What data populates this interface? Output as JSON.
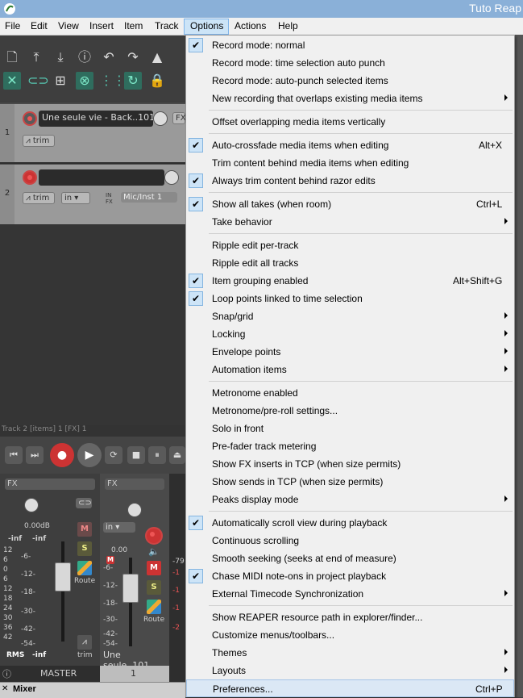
{
  "window": {
    "title": "Tuto Reap"
  },
  "menubar": [
    "File",
    "Edit",
    "View",
    "Insert",
    "Item",
    "Track",
    "Options",
    "Actions",
    "Help"
  ],
  "options_menu": [
    {
      "type": "item",
      "label": "Record mode: normal",
      "checked": true
    },
    {
      "type": "item",
      "label": "Record mode: time selection auto punch"
    },
    {
      "type": "item",
      "label": "Record mode: auto-punch selected items"
    },
    {
      "type": "item",
      "label": "New recording that overlaps existing media items",
      "submenu": true
    },
    {
      "type": "sep"
    },
    {
      "type": "item",
      "label": "Offset overlapping media items vertically"
    },
    {
      "type": "sep"
    },
    {
      "type": "item",
      "label": "Auto-crossfade media items when editing",
      "checked": true,
      "shortcut": "Alt+X"
    },
    {
      "type": "item",
      "label": "Trim content behind media items when editing"
    },
    {
      "type": "item",
      "label": "Always trim content behind razor edits",
      "checked": true
    },
    {
      "type": "sep"
    },
    {
      "type": "item",
      "label": "Show all takes (when room)",
      "checked": true,
      "shortcut": "Ctrl+L"
    },
    {
      "type": "item",
      "label": "Take behavior",
      "submenu": true
    },
    {
      "type": "sep"
    },
    {
      "type": "item",
      "label": "Ripple edit per-track"
    },
    {
      "type": "item",
      "label": "Ripple edit all tracks"
    },
    {
      "type": "item",
      "label": "Item grouping enabled",
      "checked": true,
      "shortcut": "Alt+Shift+G"
    },
    {
      "type": "item",
      "label": "Loop points linked to time selection",
      "checked": true
    },
    {
      "type": "item",
      "label": "Snap/grid",
      "submenu": true
    },
    {
      "type": "item",
      "label": "Locking",
      "submenu": true
    },
    {
      "type": "item",
      "label": "Envelope points",
      "submenu": true
    },
    {
      "type": "item",
      "label": "Automation items",
      "submenu": true
    },
    {
      "type": "sep"
    },
    {
      "type": "item",
      "label": "Metronome enabled"
    },
    {
      "type": "item",
      "label": "Metronome/pre-roll settings..."
    },
    {
      "type": "item",
      "label": "Solo in front"
    },
    {
      "type": "item",
      "label": "Pre-fader track metering"
    },
    {
      "type": "item",
      "label": "Show FX inserts in TCP (when size permits)"
    },
    {
      "type": "item",
      "label": "Show sends in TCP (when size permits)"
    },
    {
      "type": "item",
      "label": "Peaks display mode",
      "submenu": true
    },
    {
      "type": "sep"
    },
    {
      "type": "item",
      "label": "Automatically scroll view during playback",
      "checked": true
    },
    {
      "type": "item",
      "label": "Continuous scrolling"
    },
    {
      "type": "item",
      "label": "Smooth seeking (seeks at end of measure)"
    },
    {
      "type": "item",
      "label": "Chase MIDI note-ons in project playback",
      "checked": true
    },
    {
      "type": "item",
      "label": "External Timecode Synchronization",
      "submenu": true
    },
    {
      "type": "sep"
    },
    {
      "type": "item",
      "label": "Show REAPER resource path in explorer/finder..."
    },
    {
      "type": "item",
      "label": "Customize menus/toolbars..."
    },
    {
      "type": "item",
      "label": "Themes",
      "submenu": true
    },
    {
      "type": "item",
      "label": "Layouts",
      "submenu": true
    },
    {
      "type": "item",
      "label": "Preferences...",
      "shortcut": "Ctrl+P",
      "highlighted": true
    }
  ],
  "tracks": [
    {
      "number": "1",
      "name": "Une seule vie - Back..101",
      "trim": "trim",
      "fx": "FX"
    },
    {
      "number": "2",
      "name": "",
      "trim": "trim",
      "input": "in",
      "input_fx": "IN FX",
      "input_name": "Mic/Inst 1"
    }
  ],
  "status_line": "Track 2 [items] 1 [FX] 1",
  "mixer": {
    "master": {
      "fx": "FX",
      "volume": "0.00dB",
      "peak_l": "-inf",
      "peak_r": "-inf",
      "scale_l": [
        "12",
        "6",
        "0",
        "6",
        "12",
        "18",
        "24",
        "30",
        "36",
        "42"
      ],
      "scale_r": [
        "-6-",
        "-12-",
        "-18-",
        "-30-",
        "-42-",
        "-54-"
      ],
      "m": "M",
      "s": "S",
      "route": "Route",
      "trim": "trim",
      "rms_label": "RMS",
      "rms_value": "-inf",
      "name": "MASTER"
    },
    "track1": {
      "fx": "FX",
      "volume": "0.00",
      "input": "in",
      "scale": [
        "-6-",
        "-12-",
        "-18-",
        "-30-",
        "-42-",
        "-54-"
      ],
      "m": "M",
      "s": "S",
      "route": "Route",
      "name": "Une seule..101",
      "number": "1"
    },
    "track2_partial": {
      "value": "-79",
      "scale": [
        "-1",
        "-1",
        "-1",
        "-2"
      ]
    },
    "tab_label": "Mixer"
  },
  "colors": {
    "accent": "#8ab0d8",
    "checked_bg": "#cde4f7",
    "menu_bg": "#f0f0f0",
    "record_red": "#cc3b3b",
    "toggle_green": "#2f6d5e"
  },
  "toolbar_icons": [
    "new-file-icon",
    "save-icon",
    "load-icon",
    "info-icon",
    "undo-icon",
    "redo-icon",
    "metronome-icon",
    "ripple-icon",
    "link-icon",
    "grid-icon",
    "group-icon",
    "snap-icon",
    "loop-icon",
    "lock-icon"
  ]
}
